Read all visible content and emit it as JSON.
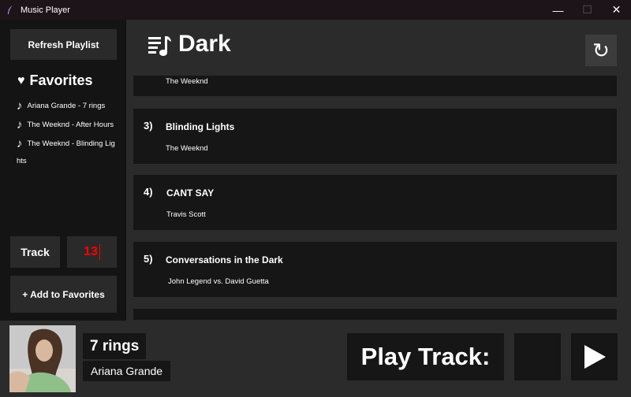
{
  "window": {
    "title": "Music Player",
    "controls": {
      "minimize": "—",
      "maximize": "☐",
      "close": "✕"
    }
  },
  "sidebar": {
    "refresh_label": "Refresh Playlist",
    "favorites_heading": "Favorites",
    "favorites": [
      "Ariana Grande - 7 rings",
      "The Weeknd - After Hours",
      "The Weeknd - Blinding Lights"
    ],
    "track_label": "Track",
    "track_number": "13",
    "add_favorites_label": "+ Add to Favorites"
  },
  "playlist": {
    "title": "Dark",
    "reload_glyph": "↻",
    "songs": [
      {
        "number": "",
        "title": "",
        "artist": "The Weeknd"
      },
      {
        "number": "3)",
        "title": "Blinding Lights",
        "artist": "The Weeknd"
      },
      {
        "number": "4)",
        "title": "CANT SAY",
        "artist": "Travis Scott"
      },
      {
        "number": "5)",
        "title": "Conversations in the Dark",
        "artist": "John Legend vs. David Guetta"
      }
    ]
  },
  "now_playing": {
    "title": "7 rings",
    "artist": "Ariana Grande",
    "play_label": "Play Track:",
    "play_input_value": ""
  },
  "colors": {
    "track_number": "#ff0000",
    "card": "#161616",
    "background": "#2b2b2b"
  }
}
